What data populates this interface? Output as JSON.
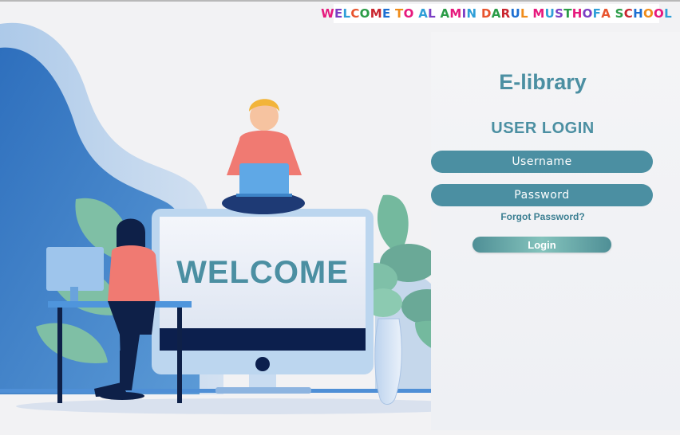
{
  "banner": {
    "text": "WELCOME TO AL AMIN DARUL MUSTHOFA SCHOOL",
    "letter_colors": [
      "#e6197d",
      "#7b3fc4",
      "#2f9fd8",
      "#e8542e",
      "#2b9c47",
      "#c9262f",
      "#1d6fd2",
      "#f08c1a",
      "#e6197d",
      "#2f9fd8",
      "#7b3fc4",
      "#2b9c47"
    ]
  },
  "illustration": {
    "monitor_text": "WELCOME"
  },
  "login": {
    "app_title": "E-library",
    "section_title": "USER LOGIN",
    "username_placeholder": "Username",
    "password_placeholder": "Password",
    "forgot_label": "Forgot Password?",
    "login_button_label": "Login"
  },
  "colors": {
    "accent": "#4b8fa2",
    "background": "#f2f2f4"
  }
}
